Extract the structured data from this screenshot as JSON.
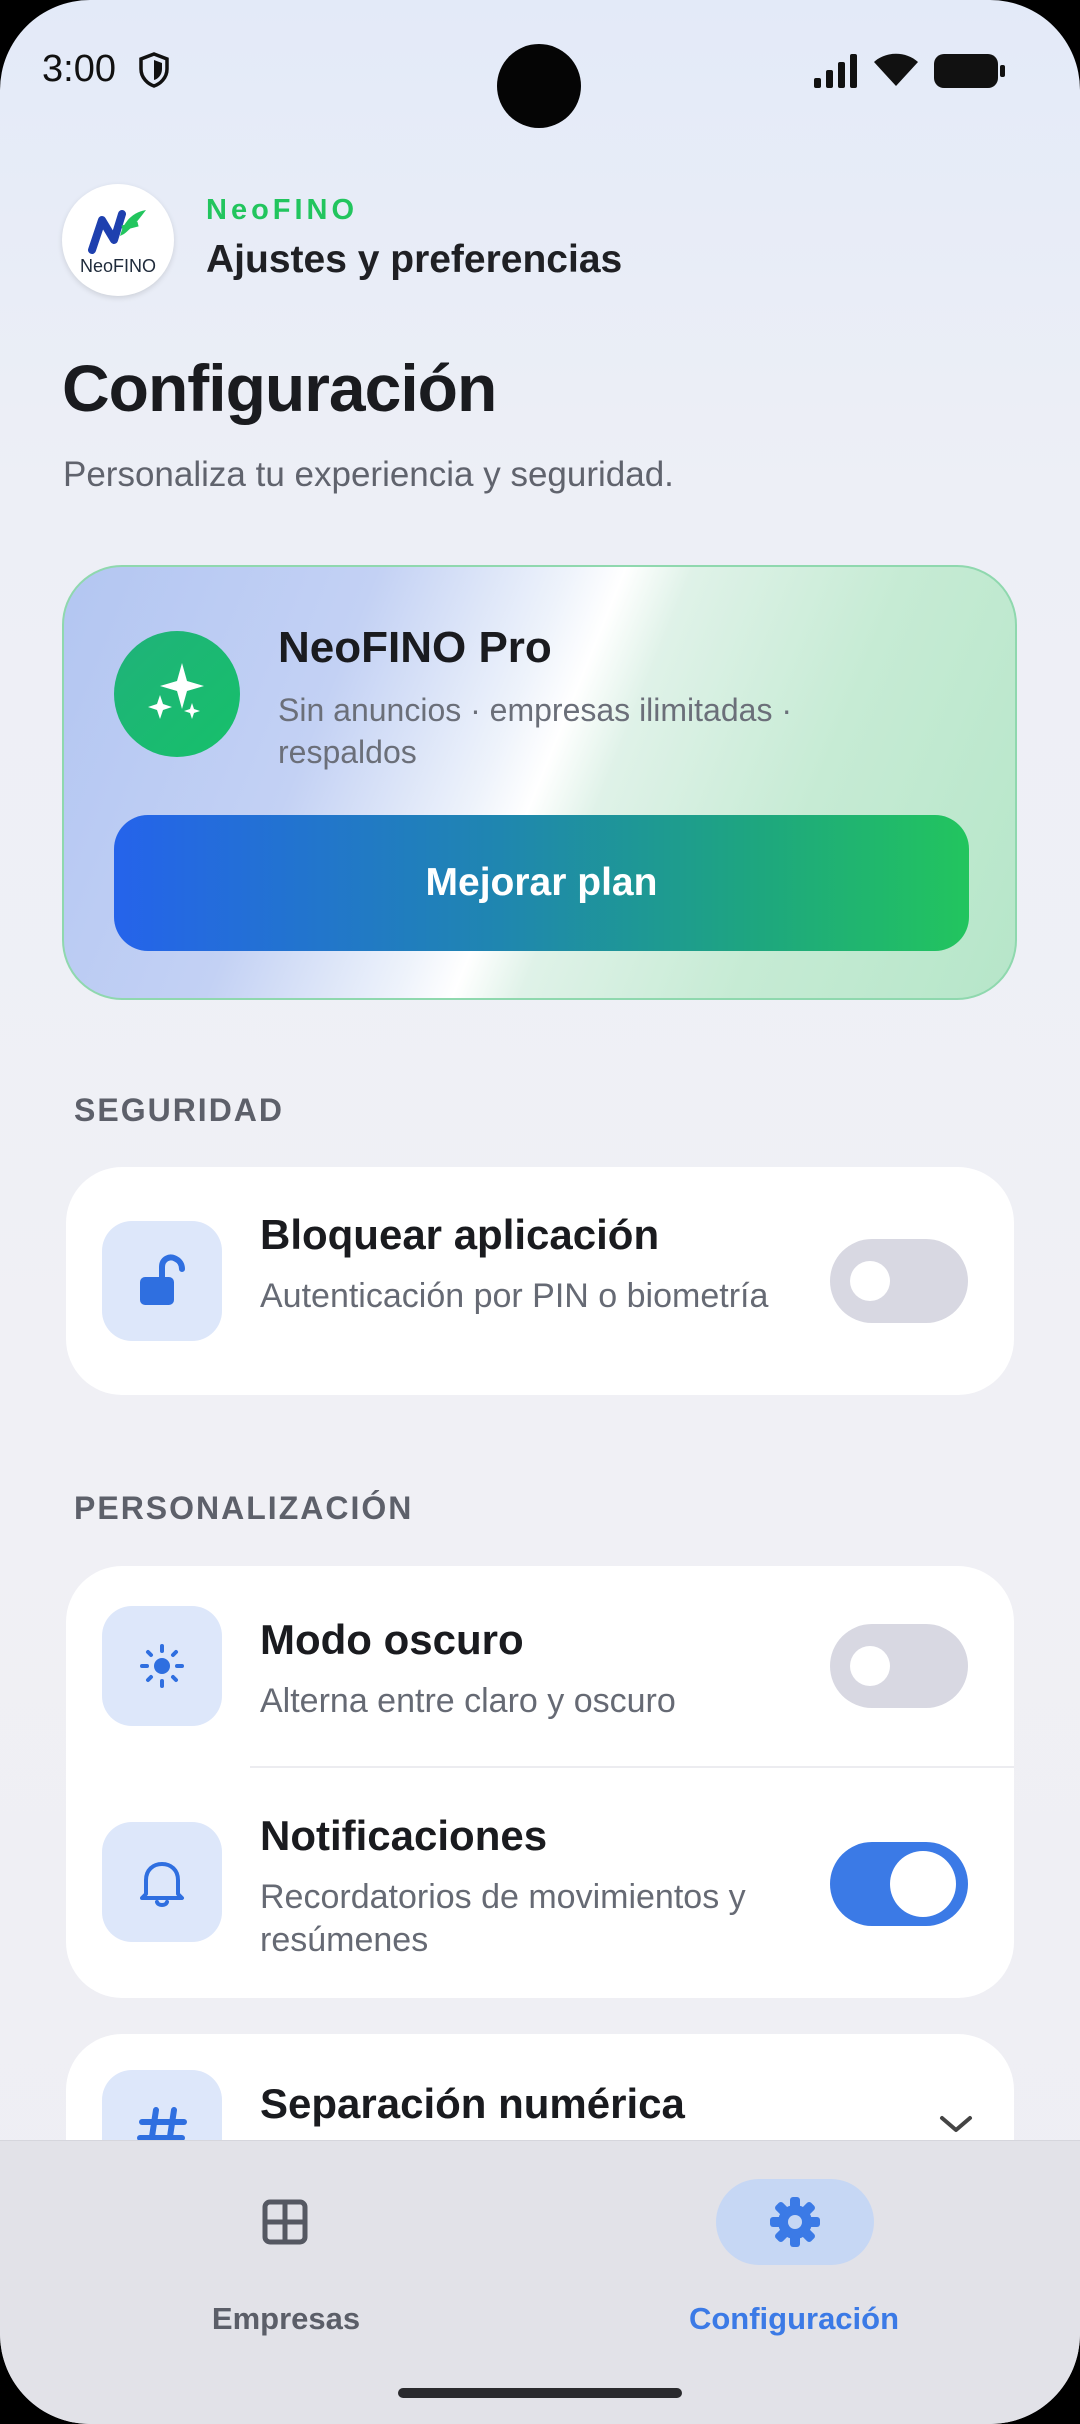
{
  "status_bar": {
    "time": "3:00"
  },
  "header": {
    "logo_text": "NeoFINO",
    "brand": "NeoFINO",
    "subtitle": "Ajustes y preferencias"
  },
  "page": {
    "title": "Configuración",
    "description": "Personaliza tu experiencia y seguridad."
  },
  "pro_card": {
    "title": "NeoFINO Pro",
    "description": "Sin anuncios · empresas ilimitadas · respaldos",
    "button_label": "Mejorar plan"
  },
  "sections": {
    "security": {
      "label": "SEGURIDAD",
      "lock_app": {
        "title": "Bloquear aplicación",
        "description": "Autenticación por PIN o biometría",
        "enabled": false
      }
    },
    "personalization": {
      "label": "PERSONALIZACIÓN",
      "dark_mode": {
        "title": "Modo oscuro",
        "description": "Alterna entre claro y oscuro",
        "enabled": false
      },
      "notifications": {
        "title": "Notificaciones",
        "description": "Recordatorios de movimientos y resúmenes",
        "enabled": true
      },
      "number_separation": {
        "title": "Separación numérica"
      }
    }
  },
  "bottom_nav": {
    "items": [
      {
        "label": "Empresas",
        "icon": "grid-icon",
        "active": false
      },
      {
        "label": "Configuración",
        "icon": "gear-icon",
        "active": true
      }
    ]
  },
  "colors": {
    "accent_blue": "#3b7ae6",
    "brand_green": "#22c55e",
    "icon_blue": "#2f6fe0"
  }
}
